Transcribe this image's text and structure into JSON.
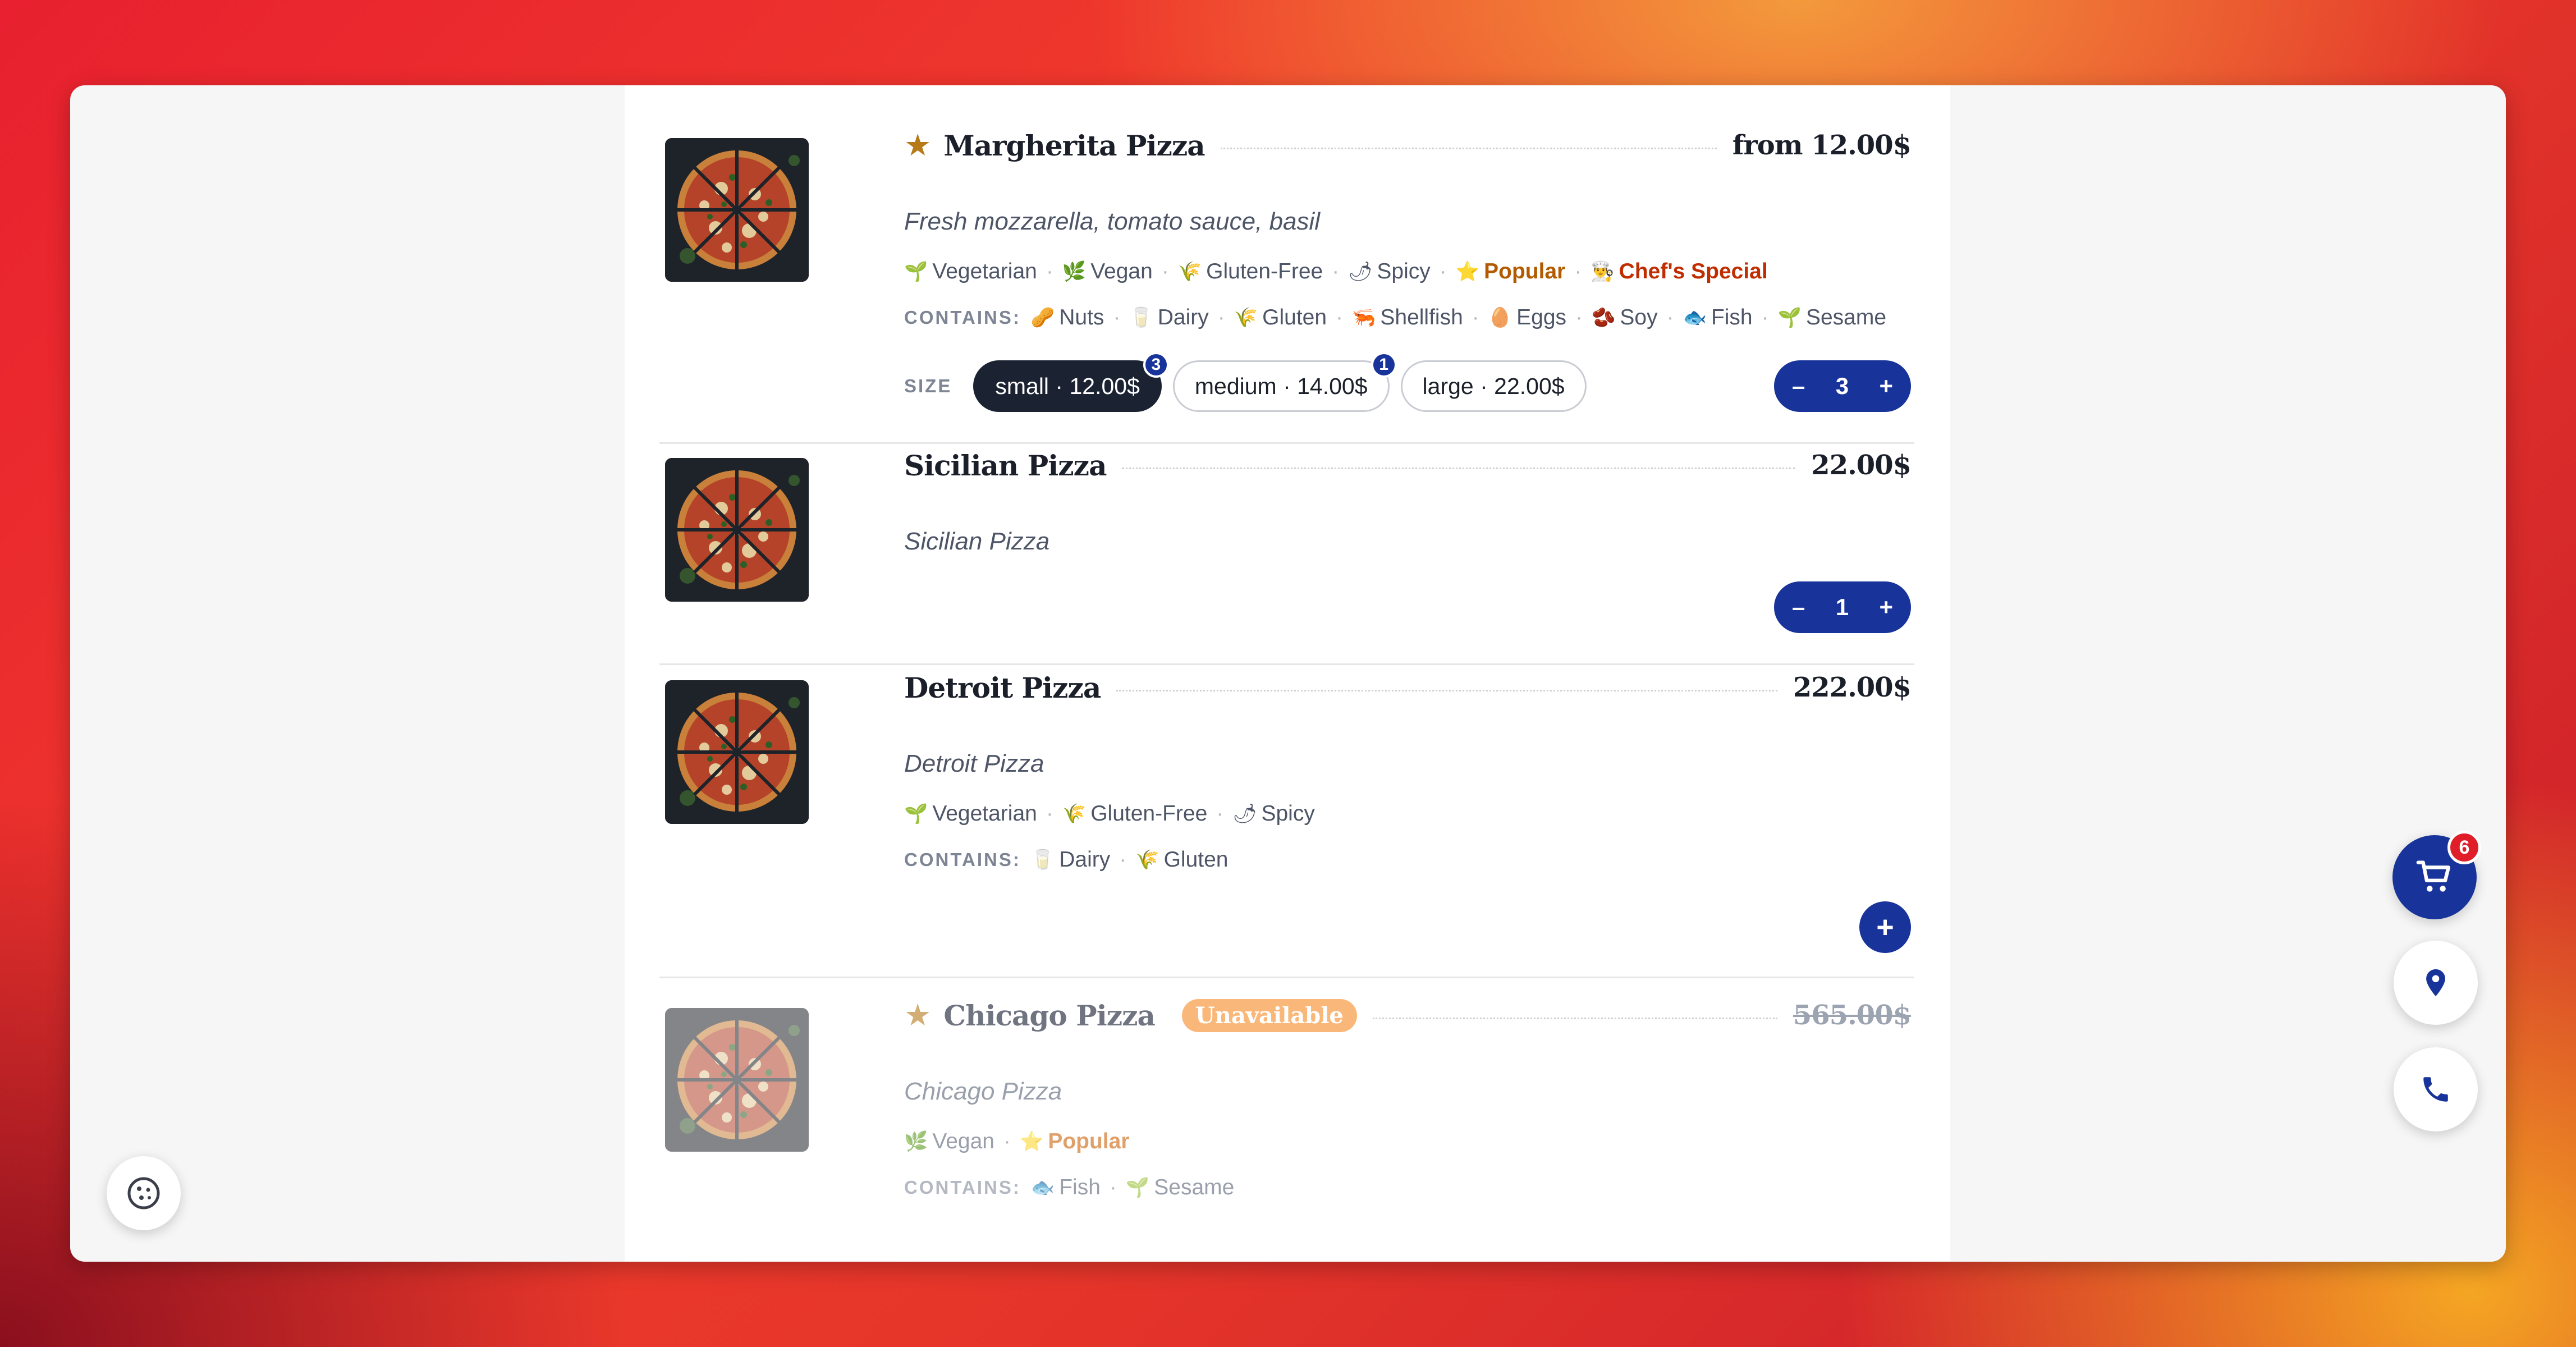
{
  "menu": {
    "items": [
      {
        "name": "Margherita Pizza",
        "featured": true,
        "price": "from 12.00$",
        "description": "Fresh mozzarella, tomato sauce, basil",
        "tags": [
          {
            "label": "Vegetarian",
            "icon": "sprout-icon"
          },
          {
            "label": "Vegan",
            "icon": "leaf-icon"
          },
          {
            "label": "Gluten-Free",
            "icon": "wheat-icon"
          },
          {
            "label": "Spicy",
            "icon": "chili-icon"
          },
          {
            "label": "Popular",
            "icon": "star-icon"
          },
          {
            "label": "Chef's Special",
            "icon": "chef-icon"
          }
        ],
        "contains_label": "CONTAINS:",
        "allergens": [
          {
            "label": "Nuts",
            "icon": "nut-icon"
          },
          {
            "label": "Dairy",
            "icon": "milk-icon"
          },
          {
            "label": "Gluten",
            "icon": "wheat-icon"
          },
          {
            "label": "Shellfish",
            "icon": "shrimp-icon"
          },
          {
            "label": "Eggs",
            "icon": "egg-icon"
          },
          {
            "label": "Soy",
            "icon": "soy-icon"
          },
          {
            "label": "Fish",
            "icon": "fish-icon"
          },
          {
            "label": "Sesame",
            "icon": "sesame-icon"
          }
        ],
        "size_label": "SIZE",
        "sizes": [
          {
            "label": "small · 12.00$",
            "count": "3",
            "selected": true
          },
          {
            "label": "medium · 14.00$",
            "count": "1",
            "selected": false
          },
          {
            "label": "large · 22.00$",
            "count": "",
            "selected": false
          }
        ],
        "quantity": "3"
      },
      {
        "name": "Sicilian Pizza",
        "featured": false,
        "price": "22.00$",
        "description": "Sicilian Pizza",
        "quantity": "1"
      },
      {
        "name": "Detroit Pizza",
        "featured": false,
        "price": "222.00$",
        "description": "Detroit Pizza",
        "tags": [
          {
            "label": "Vegetarian",
            "icon": "sprout-icon"
          },
          {
            "label": "Gluten-Free",
            "icon": "wheat-icon"
          },
          {
            "label": "Spicy",
            "icon": "chili-icon"
          }
        ],
        "contains_label": "CONTAINS:",
        "allergens": [
          {
            "label": "Dairy",
            "icon": "milk-icon"
          },
          {
            "label": "Gluten",
            "icon": "wheat-icon"
          }
        ]
      },
      {
        "name": "Chicago Pizza",
        "featured": true,
        "status": "Unavailable",
        "price": "565.00$",
        "description": "Chicago Pizza",
        "tags": [
          {
            "label": "Vegan",
            "icon": "leaf-icon"
          },
          {
            "label": "Popular",
            "icon": "star-icon"
          }
        ],
        "contains_label": "CONTAINS:",
        "allergens": [
          {
            "label": "Fish",
            "icon": "fish-icon"
          },
          {
            "label": "Sesame",
            "icon": "sesame-icon"
          }
        ]
      }
    ]
  },
  "stepper": {
    "minus": "–",
    "plus": "+"
  },
  "cart": {
    "count": "6"
  },
  "colors": {
    "accent": "#183399",
    "dark_pill": "#1b2232",
    "popular": "#b35a00",
    "chef_special": "#c02d00",
    "star": "#b67a18",
    "unavailable": "#f9b87a",
    "cart_badge": "#e01e2a"
  }
}
